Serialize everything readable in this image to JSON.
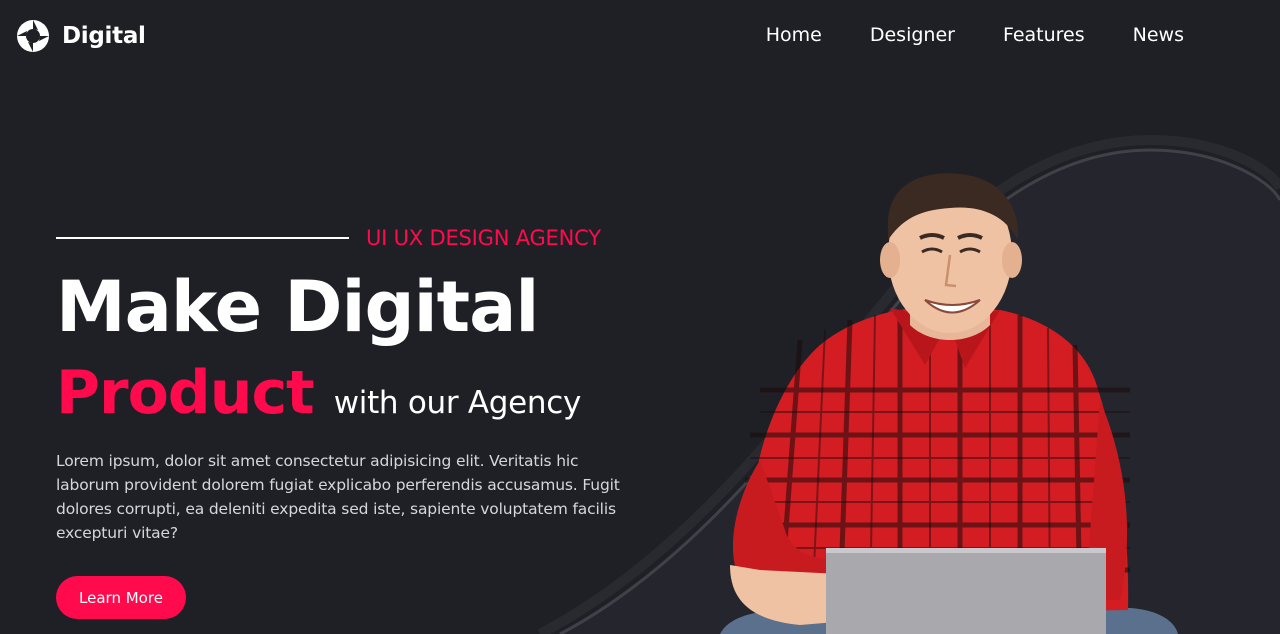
{
  "brand": {
    "name": "Digital",
    "logo_icon": "aperture-icon"
  },
  "nav": {
    "items": [
      {
        "label": "Home"
      },
      {
        "label": "Designer"
      },
      {
        "label": "Features"
      },
      {
        "label": "News"
      }
    ]
  },
  "hero": {
    "tagline": "UI UX DESIGN AGENCY",
    "headline_line1": "Make Digital",
    "headline_accent": "Product",
    "headline_rest": "with our Agency",
    "description": "Lorem ipsum, dolor sit amet consectetur adipisicing elit. Veritatis hic laborum provident dolorem fugiat explicabo perferendis accusamus. Fugit dolores corrupti, ea deleniti expedita sed iste, sapiente voluptatem facilis excepturi vitae?",
    "cta_label": "Learn More",
    "image": "smiling-man-laptop-photo"
  },
  "colors": {
    "background": "#1f2026",
    "accent": "#ff0a4d",
    "text": "#ffffff"
  }
}
